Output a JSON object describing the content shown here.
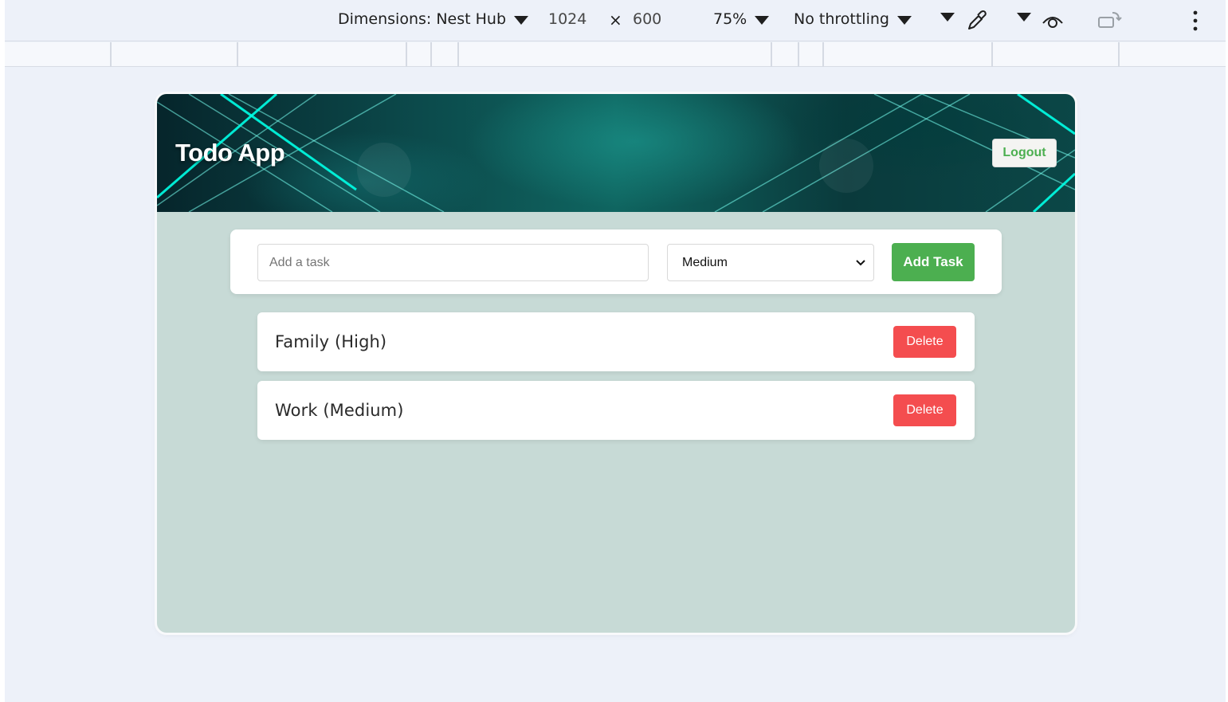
{
  "devtools": {
    "dimensions_label": "Dimensions: Nest Hub",
    "width": "1024",
    "times": "×",
    "height": "600",
    "zoom": "75%",
    "throttling": "No throttling",
    "icons": [
      "dropdown-arrow-icon",
      "eyedropper-icon",
      "eye-icon",
      "rotate-icon",
      "more-vert-icon"
    ]
  },
  "app": {
    "title": "Todo App",
    "logout_label": "Logout",
    "accent_color": "#4caf50",
    "delete_color": "#f44d4f"
  },
  "add_form": {
    "input_placeholder": "Add a task",
    "input_value": "",
    "priority_selected": "Medium",
    "add_label": "Add Task"
  },
  "tasks": [
    {
      "label": "Family (High)",
      "delete_label": "Delete"
    },
    {
      "label": "Work (Medium)",
      "delete_label": "Delete"
    }
  ]
}
